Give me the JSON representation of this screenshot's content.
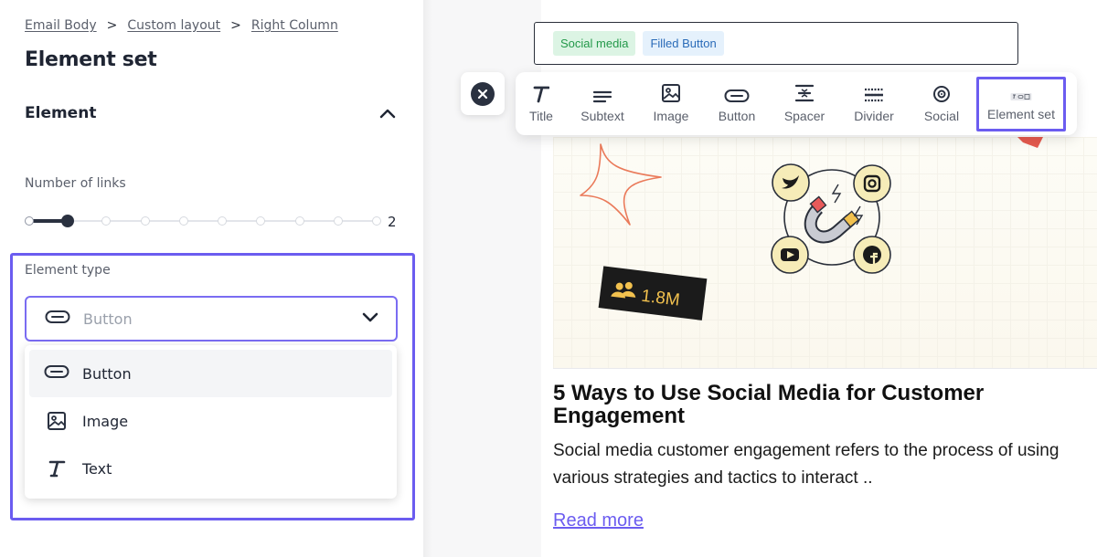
{
  "breadcrumb": [
    "Email Body",
    "Custom layout",
    "Right Column"
  ],
  "breadcrumb_separator": ">",
  "panel": {
    "title": "Element set",
    "section_label": "Element",
    "links_label": "Number of links",
    "links_value": "2",
    "slider": {
      "value": 2,
      "max": 10
    },
    "type_label": "Element type",
    "selected_type": "Button",
    "options": [
      {
        "label": "Button",
        "icon": "button-pill-icon"
      },
      {
        "label": "Image",
        "icon": "image-icon"
      },
      {
        "label": "Text",
        "icon": "text-italic-t-icon"
      }
    ]
  },
  "tags": {
    "social": "Social media",
    "filled": "Filled Button"
  },
  "toolbar": {
    "items": [
      {
        "label": "Title",
        "icon": "title-icon"
      },
      {
        "label": "Subtext",
        "icon": "subtext-icon"
      },
      {
        "label": "Image",
        "icon": "image-icon"
      },
      {
        "label": "Button",
        "icon": "button-icon"
      },
      {
        "label": "Spacer",
        "icon": "spacer-icon"
      },
      {
        "label": "Divider",
        "icon": "divider-icon"
      },
      {
        "label": "Social",
        "icon": "social-icon"
      },
      {
        "label": "Element set",
        "icon": "element-set-icon"
      }
    ],
    "active": "Element set"
  },
  "hero": {
    "badge_text": "1.8M"
  },
  "article": {
    "title": "5 Ways to Use Social Media for Customer Engagement",
    "body": "Social media customer engagement refers to the process of using various strategies and tactics to interact ..",
    "read_more": "Read more"
  },
  "colors": {
    "accent": "#6b5cf0",
    "dark": "#2a3140"
  }
}
